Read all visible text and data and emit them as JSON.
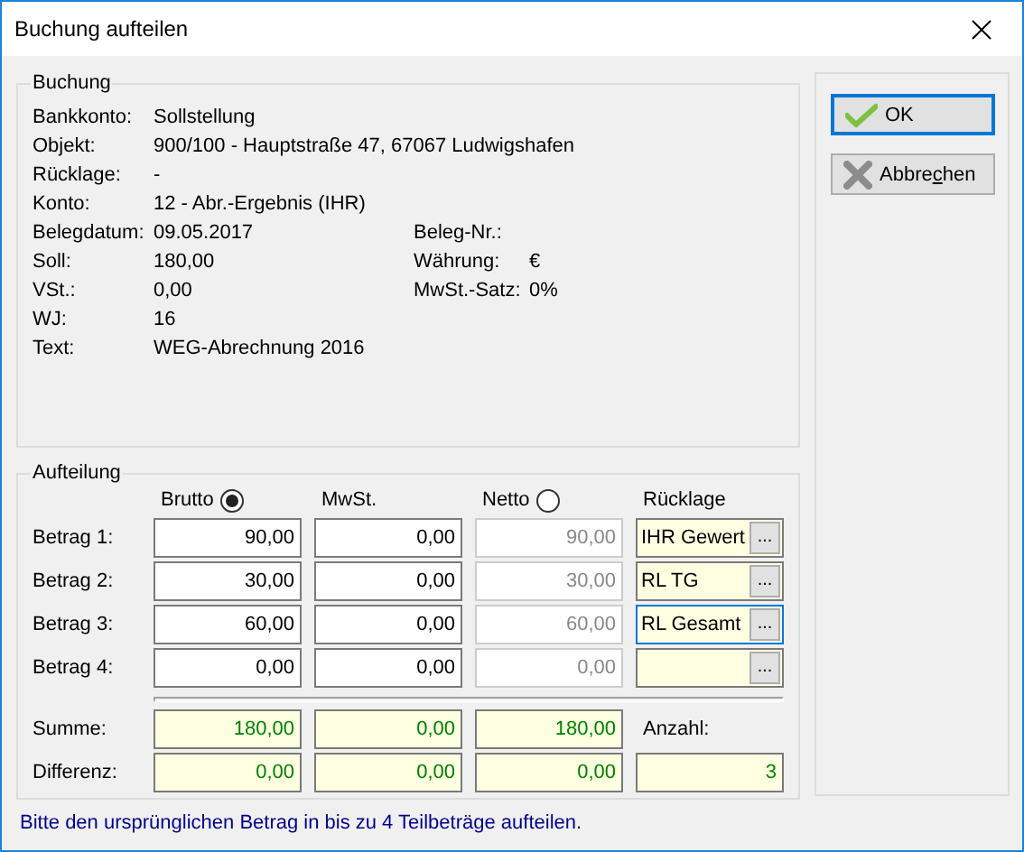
{
  "window": {
    "title": "Buchung aufteilen"
  },
  "buchung": {
    "title": "Buchung",
    "rows": [
      {
        "label": "Bankkonto:",
        "value": "Sollstellung"
      },
      {
        "label": "Objekt:",
        "value": "900/100 - Hauptstraße 47, 67067 Ludwigshafen"
      },
      {
        "label": "Rücklage:",
        "value": "-"
      },
      {
        "label": "Konto:",
        "value": "12 - Abr.-Ergebnis (IHR)"
      },
      {
        "label": "Belegdatum:",
        "value": "09.05.2017",
        "side_label": "Beleg-Nr.:"
      },
      {
        "label": "Soll:",
        "value": "180,00",
        "side_label": "Währung:",
        "side_value": "€"
      },
      {
        "label": "VSt.:",
        "value": "0,00",
        "side_label": "MwSt.-Satz:",
        "side_value": "0%"
      },
      {
        "label": "WJ:",
        "value": "16"
      },
      {
        "label": "Text:",
        "value": "WEG-Abrechnung 2016"
      }
    ]
  },
  "aufteilung": {
    "title": "Aufteilung",
    "columns": [
      {
        "label": "Brutto",
        "kind": "radio",
        "selected": true
      },
      {
        "label": "MwSt.",
        "kind": "plain"
      },
      {
        "label": "Netto",
        "kind": "radio",
        "selected": false
      },
      {
        "label": "Rücklage",
        "kind": "plain"
      }
    ],
    "rows": [
      {
        "label": "Betrag 1:",
        "cells": [
          {
            "value": "90,00",
            "disabled": false
          },
          {
            "value": "0,00",
            "disabled": false
          },
          {
            "value": "90,00",
            "disabled": true
          }
        ],
        "reserve": {
          "value": "IHR Gewert",
          "focused": false,
          "button": "..."
        }
      },
      {
        "label": "Betrag 2:",
        "cells": [
          {
            "value": "30,00",
            "disabled": false
          },
          {
            "value": "0,00",
            "disabled": false
          },
          {
            "value": "30,00",
            "disabled": true
          }
        ],
        "reserve": {
          "value": "RL TG",
          "focused": false,
          "button": "..."
        }
      },
      {
        "label": "Betrag 3:",
        "cells": [
          {
            "value": "60,00",
            "disabled": false
          },
          {
            "value": "0,00",
            "disabled": false
          },
          {
            "value": "60,00",
            "disabled": true
          }
        ],
        "reserve": {
          "value": "RL Gesamt",
          "focused": true,
          "button": "..."
        }
      },
      {
        "label": "Betrag 4:",
        "cells": [
          {
            "value": "0,00",
            "disabled": false
          },
          {
            "value": "0,00",
            "disabled": false
          },
          {
            "value": "0,00",
            "disabled": true
          }
        ],
        "reserve": {
          "focused": false,
          "button": "..."
        }
      }
    ],
    "totals": [
      {
        "label": "Summe:",
        "values": [
          "180,00",
          "0,00",
          "180,00"
        ],
        "side_label": "Anzahl:"
      },
      {
        "label": "Differenz:",
        "values": [
          "0,00",
          "0,00",
          "0,00"
        ],
        "side_value": "3"
      }
    ]
  },
  "buttons": [
    {
      "label_parts": [
        {
          "text": "OK",
          "underlined": false
        }
      ],
      "kind": "ok",
      "focused": true
    },
    {
      "label_parts": [
        {
          "text": "Abbre",
          "underlined": false
        },
        {
          "text": "c",
          "underlined": true
        },
        {
          "text": "hen",
          "underlined": false
        }
      ],
      "kind": "cancel",
      "focused": false
    }
  ],
  "footer": "Bitte den ursprünglichen Betrag in bis zu 4 Teilbeträge aufteilen."
}
